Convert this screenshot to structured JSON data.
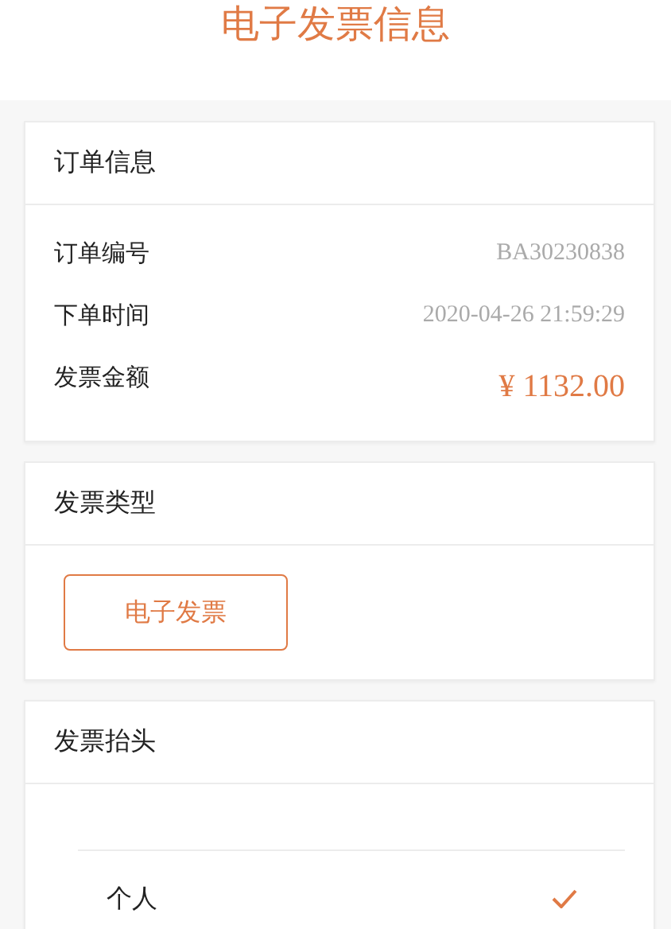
{
  "header": {
    "title": "电子发票信息"
  },
  "order": {
    "title": "订单信息",
    "rows": [
      {
        "label": "订单编号",
        "value": "BA30230838",
        "kind": "plain"
      },
      {
        "label": "下单时间",
        "value": "2020-04-26 21:59:29",
        "kind": "plain"
      },
      {
        "label": "发票金额",
        "value": "¥ 1132.00",
        "kind": "amount"
      }
    ]
  },
  "invoice_type": {
    "title": "发票类型",
    "options": [
      {
        "label": "电子发票",
        "selected": true
      }
    ]
  },
  "invoice_header": {
    "title": "发票抬头",
    "options": [
      {
        "label": "个人",
        "selected": true
      }
    ]
  }
}
